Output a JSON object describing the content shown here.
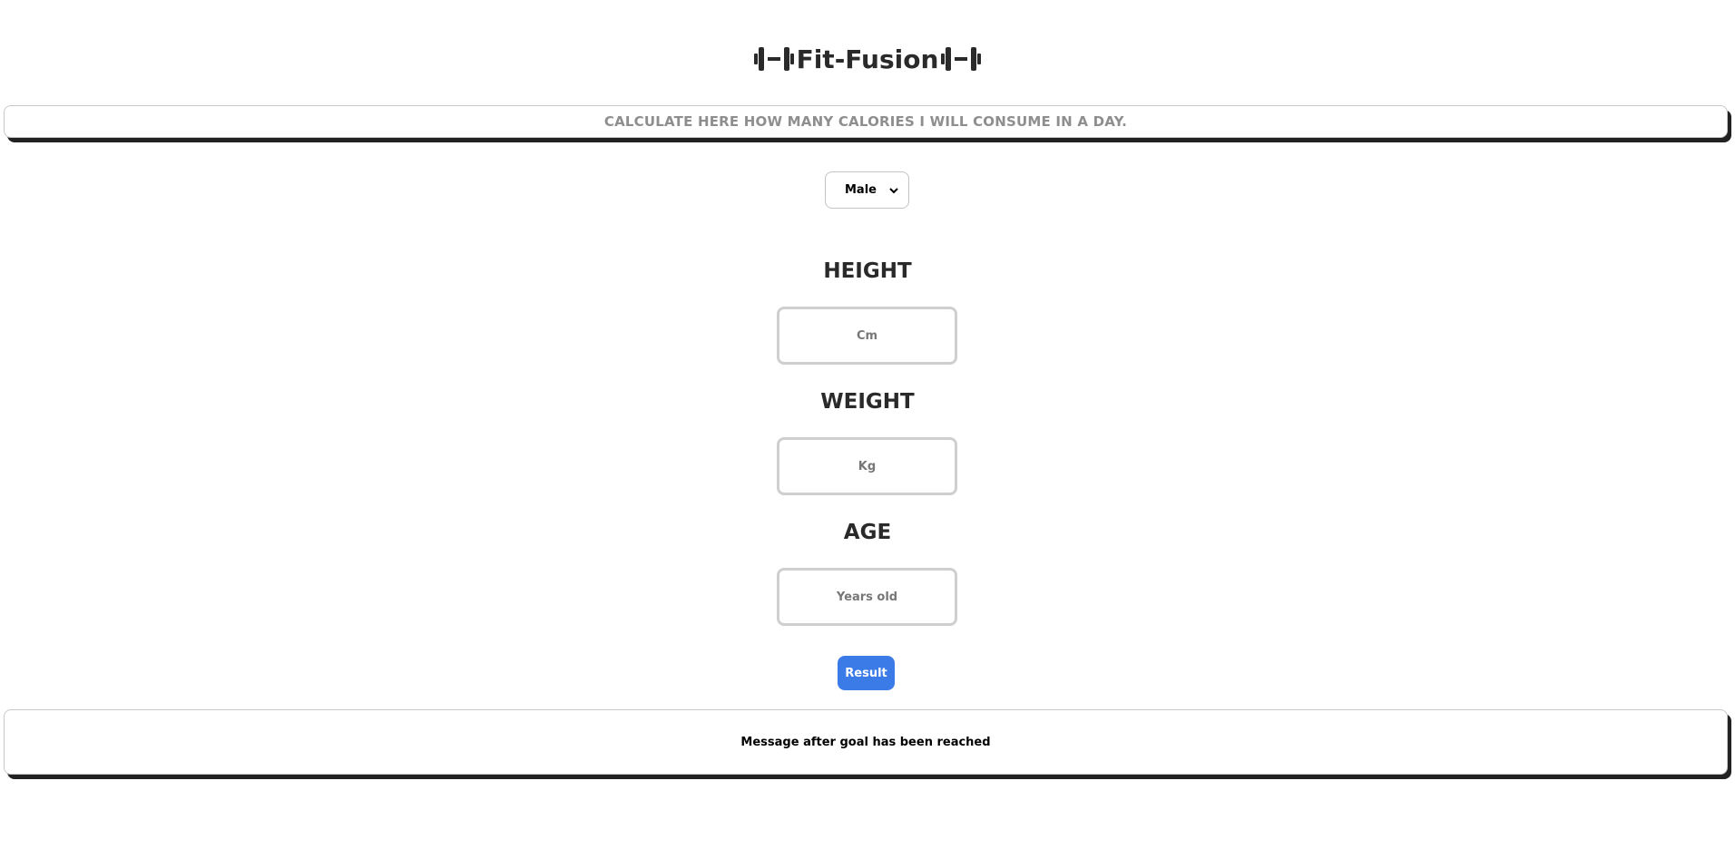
{
  "header": {
    "title": "Fit-Fusion",
    "icon": "dumbbell-icon"
  },
  "banner": {
    "text": "CALCULATE HERE HOW MANY CALORIES I WILL CONSUME IN A DAY."
  },
  "gender_select": {
    "selected": "Male",
    "icon": "chevron-down-icon"
  },
  "height": {
    "label": "HEIGHT",
    "placeholder": "Cm",
    "value": ""
  },
  "weight": {
    "label": "WEIGHT",
    "placeholder": "Kg",
    "value": ""
  },
  "age": {
    "label": "AGE",
    "placeholder": "Years old",
    "value": ""
  },
  "result_button": {
    "label": "Result",
    "color": "#3b7be8"
  },
  "message": {
    "text": "Message after goal has been reached"
  }
}
